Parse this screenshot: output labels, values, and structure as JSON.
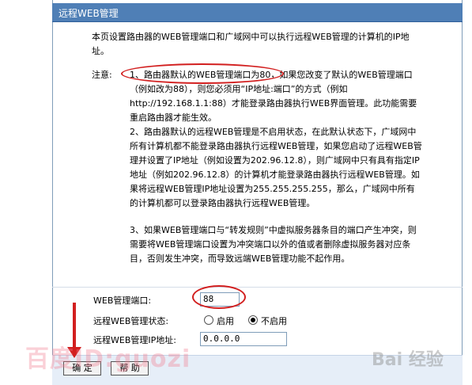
{
  "window": {
    "title": "远程WEB管理"
  },
  "intro": "本页设置路由器的WEB管理端口和广域网中可以执行远程WEB管理的计算机的IP地址。",
  "notes_label": "注意:",
  "notes": [
    "1、路由器默认的WEB管理端口为80，如果您改变了默认的WEB管理端口（例如改为88），则您必须用“IP地址:端口”的方式（例如http://192.168.1.1:88）才能登录路由器执行WEB界面管理。此功能需要重启路由器才能生效。",
    "2、路由器默认的远程WEB管理是不启用状态，在此默认状态下，广域网中所有计算机都不能登录路由器执行远程WEB管理，如果您启动了远程WEB管理并设置了IP地址（例如设置为202.96.12.8），则广域网中只有具有指定IP地址（例如202.96.12.8）的计算机才能登录路由器执行远程WEB管理。如果将远程WEB管理IP地址设置为255.255.255.255，那么，广域网中所有的计算机都可以登录路由器执行远程WEB管理。",
    "3、如果WEB管理端口与“转发规则”中虚拟服务器条目的端口产生冲突，则需要将WEB管理端口设置为冲突端口以外的值或者删除虚拟服务器对应条目，否则发生冲突，而导致远端WEB管理功能不起作用。"
  ],
  "form": {
    "port_label": "WEB管理端口:",
    "port_value": "88",
    "status_label": "远程WEB管理状态:",
    "status_options": [
      "启用",
      "不启用"
    ],
    "status_selected": "不启用",
    "ip_label": "远程WEB管理IP地址:",
    "ip_value": "0.0.0.0"
  },
  "buttons": {
    "ok": "确 定",
    "help": "帮 助"
  },
  "watermarks": {
    "left": "百度ID:guozi",
    "right": "Bai 经验"
  },
  "colors": {
    "title_bar": "#4f7fb6",
    "annotation": "#d21f1f",
    "bottom_bar": "#e6eef8"
  }
}
